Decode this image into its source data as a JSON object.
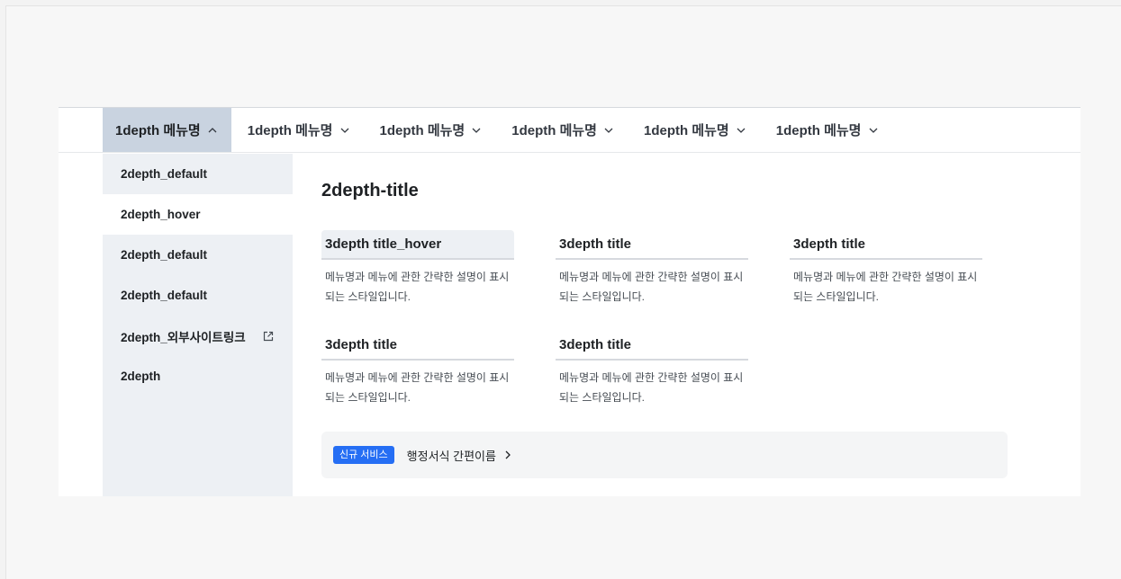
{
  "gnb": {
    "items": [
      {
        "label": "1depth 메뉴명",
        "expanded": true
      },
      {
        "label": "1depth 메뉴명",
        "expanded": false
      },
      {
        "label": "1depth 메뉴명",
        "expanded": false
      },
      {
        "label": "1depth 메뉴명",
        "expanded": false
      },
      {
        "label": "1depth 메뉴명",
        "expanded": false
      },
      {
        "label": "1depth 메뉴명",
        "expanded": false
      }
    ]
  },
  "sidebar": {
    "items": [
      {
        "label": "2depth_default"
      },
      {
        "label": "2depth_hover"
      },
      {
        "label": "2depth_default"
      },
      {
        "label": "2depth_default"
      },
      {
        "label": "2depth_외부사이트링크",
        "icon": "external-link-icon"
      },
      {
        "label": "2depth"
      }
    ]
  },
  "content": {
    "title": "2depth-title",
    "cards": [
      {
        "title": "3depth title_hover",
        "desc": "메뉴명과 메뉴에 관한 간략한 설명이 표시되는 스타일입니다."
      },
      {
        "title": "3depth title",
        "desc": "메뉴명과 메뉴에 관한 간략한 설명이 표시되는 스타일입니다."
      },
      {
        "title": "3depth title",
        "desc": "메뉴명과 메뉴에 관한 간략한 설명이 표시되는 스타일입니다."
      },
      {
        "title": "3depth title",
        "desc": "메뉴명과 메뉴에 관한 간략한 설명이 표시되는 스타일입니다."
      },
      {
        "title": "3depth title",
        "desc": "메뉴명과 메뉴에 관한 간략한 설명이 표시되는 스타일입니다."
      }
    ],
    "banner": {
      "badge": "신규 서비스",
      "link": "행정서식 간편이름"
    }
  },
  "colors": {
    "active_tab": "#c9d3e0",
    "sidebar_bg": "#edf0f4",
    "badge_bg": "#256ef4"
  }
}
